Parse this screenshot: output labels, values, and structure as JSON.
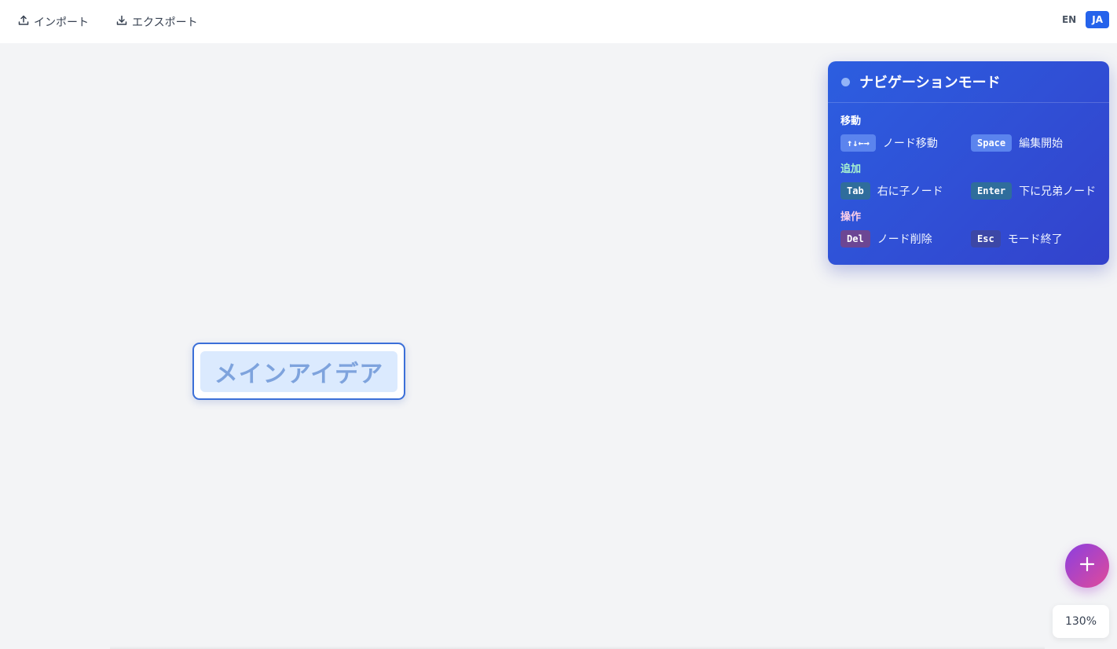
{
  "toolbar": {
    "import_label": "インポート",
    "export_label": "エクスポート",
    "import_icon": "upload-icon",
    "export_icon": "download-icon"
  },
  "language": {
    "options": [
      "EN",
      "JA"
    ],
    "selected": "JA",
    "active_color": "#2563eb"
  },
  "mindmap": {
    "root_node_text": "メインアイデア"
  },
  "nav_panel": {
    "title": "ナビゲーションモード",
    "sections": [
      {
        "title": "移動",
        "items": [
          {
            "key": "↑↓←→",
            "desc": "ノード移動"
          },
          {
            "key": "Space",
            "desc": "編集開始"
          }
        ]
      },
      {
        "title": "追加",
        "items": [
          {
            "key": "Tab",
            "desc": "右に子ノード"
          },
          {
            "key": "Enter",
            "desc": "下に兄弟ノード"
          }
        ]
      },
      {
        "title": "操作",
        "items": [
          {
            "key": "Del",
            "desc": "ノード削除"
          },
          {
            "key": "Esc",
            "desc": "モード終了"
          }
        ]
      }
    ],
    "colors": {
      "panel_gradient_start": "#2c5ee0",
      "panel_gradient_end": "#3342cc"
    }
  },
  "fab": {
    "icon": "plus-icon",
    "gradient_start": "#8b3fe0",
    "gradient_end": "#e04a9a"
  },
  "zoom": {
    "level": "130%"
  }
}
